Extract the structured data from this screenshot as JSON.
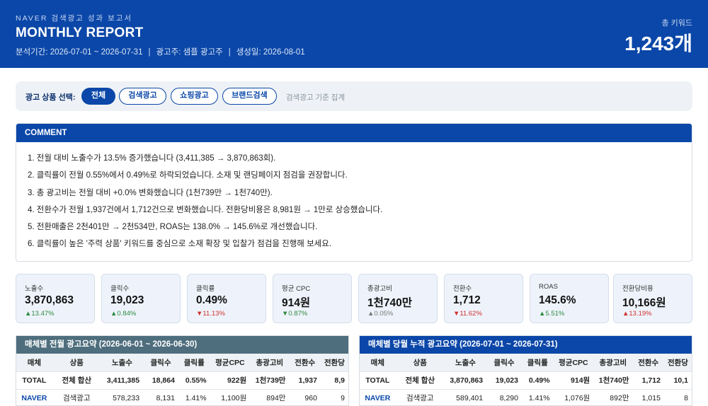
{
  "header": {
    "brand": "NAVER 검색광고 성과 보고서",
    "title": "MONTHLY REPORT",
    "period": "분석기간: 2026-07-01 ~ 2026-07-31",
    "advertiser": "광고주: 샘플 광고주",
    "generated": "생성일: 2026-08-01",
    "separator": "|",
    "keyword_label": "총 키워드",
    "keyword_value": "1,243개"
  },
  "filter": {
    "label": "광고 상품 선택:",
    "options": [
      "전체",
      "검색광고",
      "쇼핑광고",
      "브랜드검색"
    ],
    "selected": "전체",
    "note": "검색광고 기준 집계"
  },
  "comment": {
    "title": "COMMENT",
    "items": [
      "1. 전월 대비 노출수가 13.5% 증가했습니다 (3,411,385 → 3,870,863회).",
      "2. 클릭률이 전월 0.55%에서 0.49%로 하락되었습니다. 소재 및 랜딩페이지 점검을 권장합니다.",
      "3. 총 광고비는 전월 대비 +0.0% 변화했습니다 (1천739만 → 1천740만).",
      "4. 전환수가 전월 1,937건에서 1,712건으로 변화했습니다. 전환당비용은 8,981원 → 1만로 상승했습니다.",
      "5. 전환매출은 2천401만 → 2천534만, ROAS는 138.0% → 145.6%로 개선했습니다.",
      "6. 클릭률이 높은 '주력 상품' 키워드를 중심으로 소재 확장 및 입찰가 점검을 진행해 보세요."
    ]
  },
  "kpis": [
    {
      "label": "노출수",
      "value": "3,870,863",
      "delta": "▲13.47%",
      "trend": "up"
    },
    {
      "label": "클릭수",
      "value": "19,023",
      "delta": "▲0.84%",
      "trend": "up"
    },
    {
      "label": "클릭률",
      "value": "0.49%",
      "delta": "▼11.13%",
      "trend": "down"
    },
    {
      "label": "평균 CPC",
      "value": "914원",
      "delta": "▼0.87%",
      "trend": "up"
    },
    {
      "label": "총광고비",
      "value": "1천740만",
      "delta": "▲0.05%",
      "trend": "flat"
    },
    {
      "label": "전환수",
      "value": "1,712",
      "delta": "▼11.62%",
      "trend": "down"
    },
    {
      "label": "ROAS",
      "value": "145.6%",
      "delta": "▲5.51%",
      "trend": "up"
    },
    {
      "label": "전환당비용",
      "value": "10,166원",
      "delta": "▲13.19%",
      "trend": "down"
    }
  ],
  "colors": {
    "header": "#0b47a8",
    "up": "#2d8a3e",
    "down": "#d0312d",
    "prev_panel": "#4f6e7d"
  },
  "prev_table": {
    "title": "매체별 전월 광고요약 (2026-06-01 ~ 2026-06-30)",
    "columns": [
      "매체",
      "상품",
      "노출수",
      "클릭수",
      "클릭률",
      "평균CPC",
      "총광고비",
      "전환수",
      "전환당"
    ],
    "rows": [
      [
        "TOTAL",
        "전체 합산",
        "3,411,385",
        "18,864",
        "0.55%",
        "922원",
        "1천739만",
        "1,937",
        "8,9"
      ],
      [
        "NAVER",
        "검색광고",
        "578,233",
        "8,131",
        "1.41%",
        "1,100원",
        "894만",
        "960",
        "9"
      ]
    ]
  },
  "cur_table": {
    "title": "매체별 당월 누적 광고요약 (2026-07-01 ~ 2026-07-31)",
    "columns": [
      "매체",
      "상품",
      "노출수",
      "클릭수",
      "클릭률",
      "평균CPC",
      "총광고비",
      "전환수",
      "전환당"
    ],
    "rows": [
      [
        "TOTAL",
        "전체 합산",
        "3,870,863",
        "19,023",
        "0.49%",
        "914원",
        "1천740만",
        "1,712",
        "10,1"
      ],
      [
        "NAVER",
        "검색광고",
        "589,401",
        "8,290",
        "1.41%",
        "1,076원",
        "892만",
        "1,015",
        "8"
      ]
    ]
  }
}
